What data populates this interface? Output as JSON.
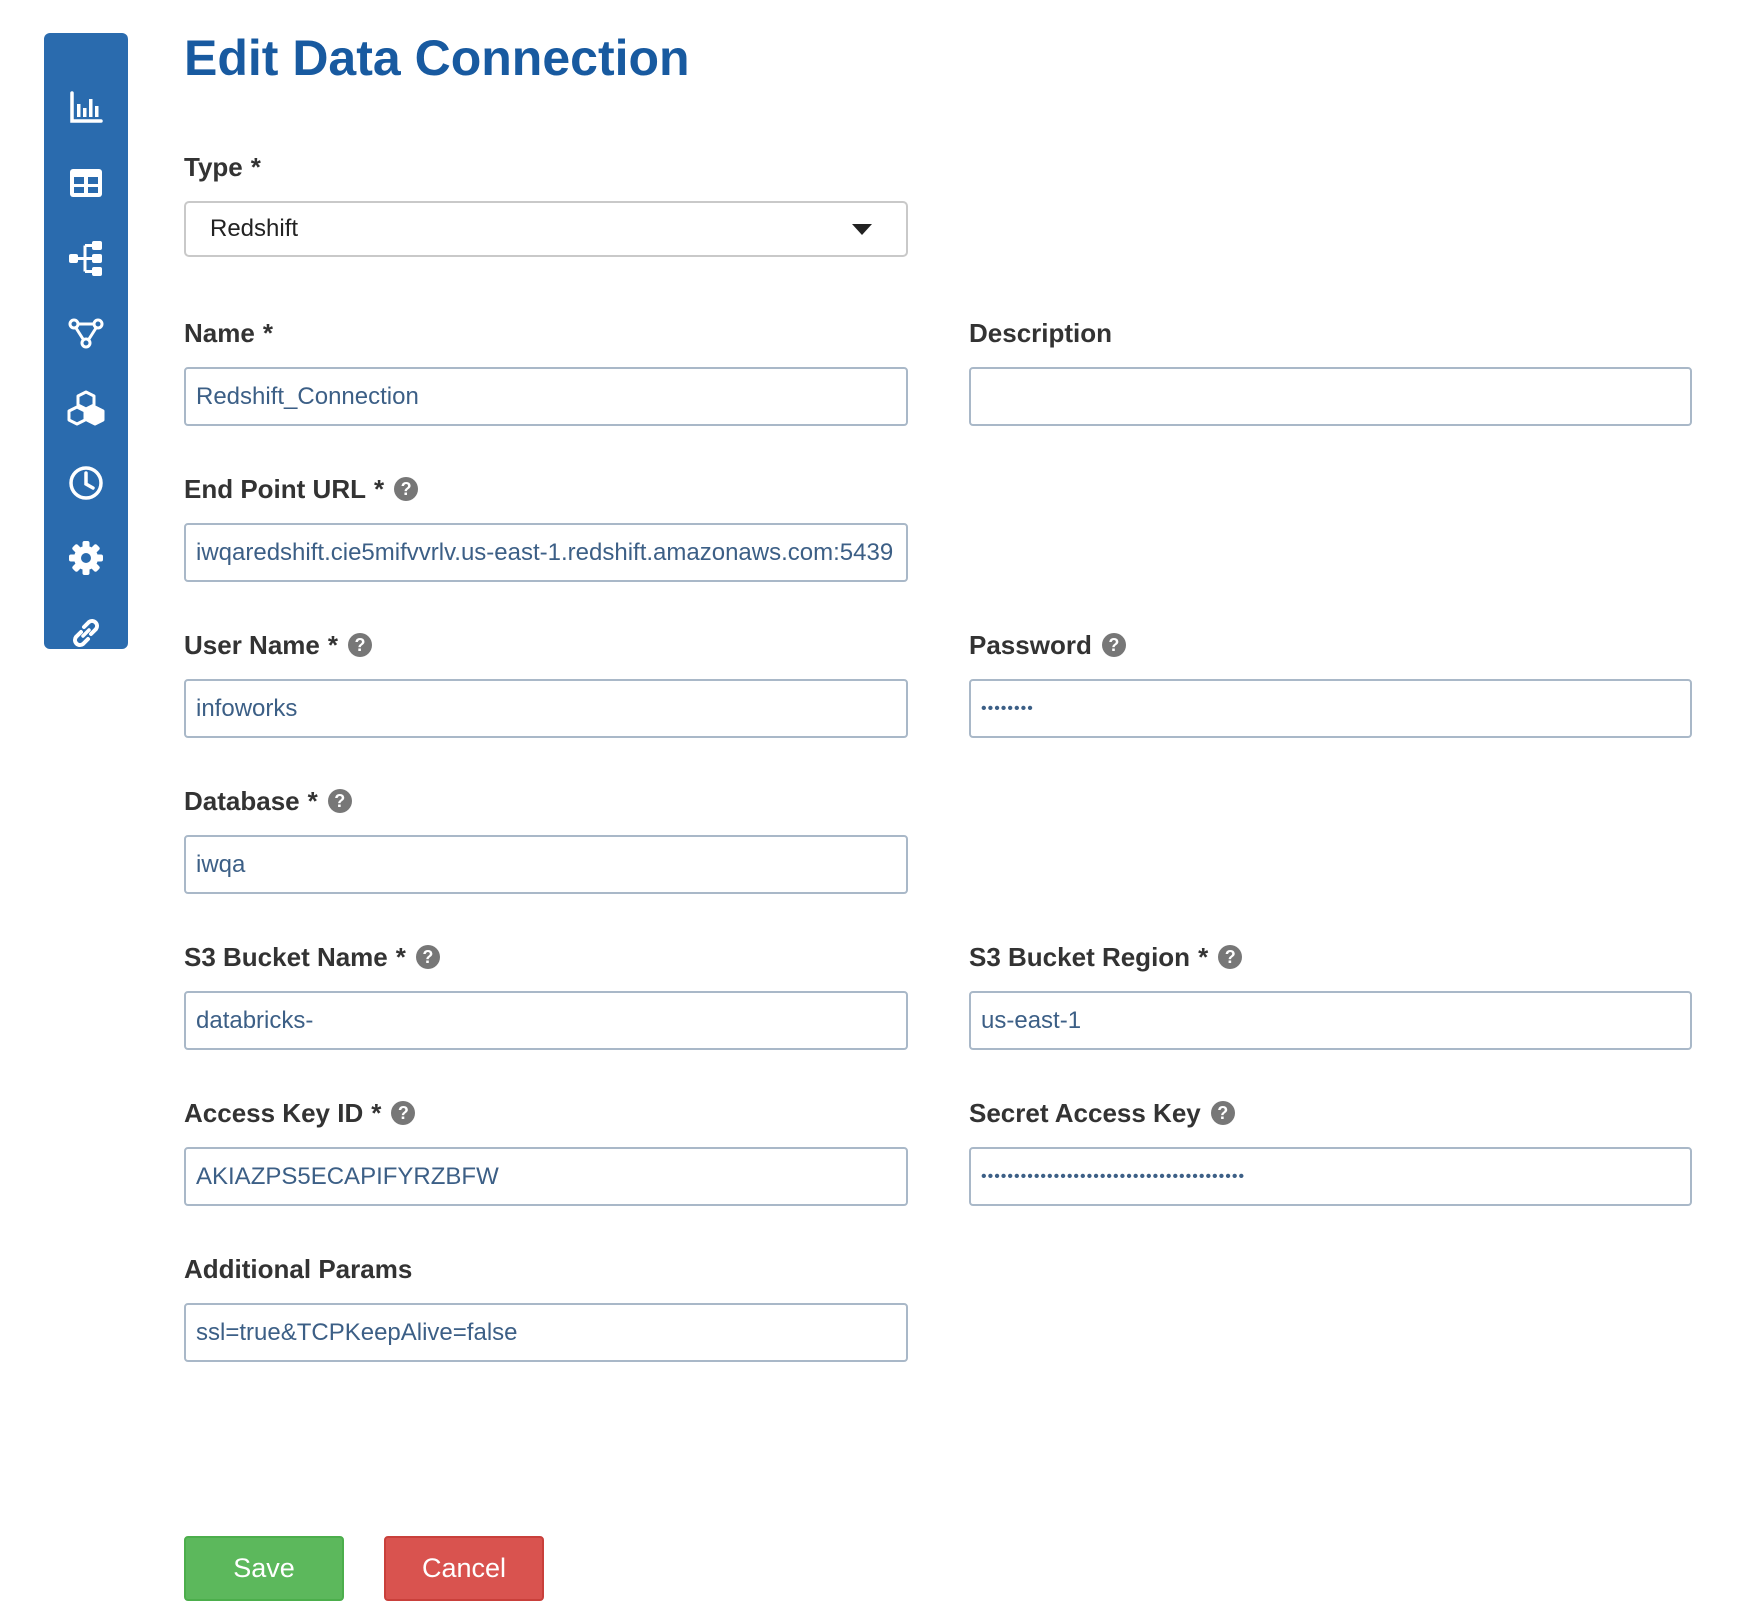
{
  "page": {
    "title": "Edit Data Connection"
  },
  "sidebar": {
    "color": "#2a6bae",
    "items": [
      {
        "icon": "bar-chart-icon"
      },
      {
        "icon": "table-icon"
      },
      {
        "icon": "hierarchy-icon"
      },
      {
        "icon": "workflow-icon"
      },
      {
        "icon": "cubes-icon"
      },
      {
        "icon": "clock-icon"
      },
      {
        "icon": "gear-icon"
      },
      {
        "icon": "link-icon"
      }
    ]
  },
  "form": {
    "required_marker": "*",
    "help_glyph": "?",
    "type": {
      "label": "Type",
      "value": "Redshift"
    },
    "name": {
      "label": "Name",
      "value": "Redshift_Connection"
    },
    "description": {
      "label": "Description",
      "value": ""
    },
    "endpoint_url": {
      "label": "End Point URL",
      "value": "iwqaredshift.cie5mifvvrlv.us-east-1.redshift.amazonaws.com:5439"
    },
    "user_name": {
      "label": "User Name",
      "value": "infoworks"
    },
    "password": {
      "label": "Password",
      "value": "iwqapass"
    },
    "database": {
      "label": "Database",
      "value": "iwqa"
    },
    "s3_bucket_name": {
      "label": "S3 Bucket Name",
      "value": "databricks-"
    },
    "s3_bucket_region": {
      "label": "S3 Bucket Region",
      "value": "us-east-1"
    },
    "access_key_id": {
      "label": "Access Key ID",
      "value": "AKIAZPS5ECAPIFYRZBFW"
    },
    "secret_access_key": {
      "label": "Secret Access Key",
      "value": "xxxxxxxxxxxxxxxxxxxxxxxxxxxxxxxxxxxxxxxx"
    },
    "additional_params": {
      "label": "Additional Params",
      "value": "ssl=true&TCPKeepAlive=false"
    }
  },
  "actions": {
    "save_label": "Save",
    "cancel_label": "Cancel",
    "save_color": "#5cb85c",
    "cancel_color": "#d9534f"
  },
  "colors": {
    "accent": "#185aa0",
    "input_text": "#3c5f86"
  }
}
